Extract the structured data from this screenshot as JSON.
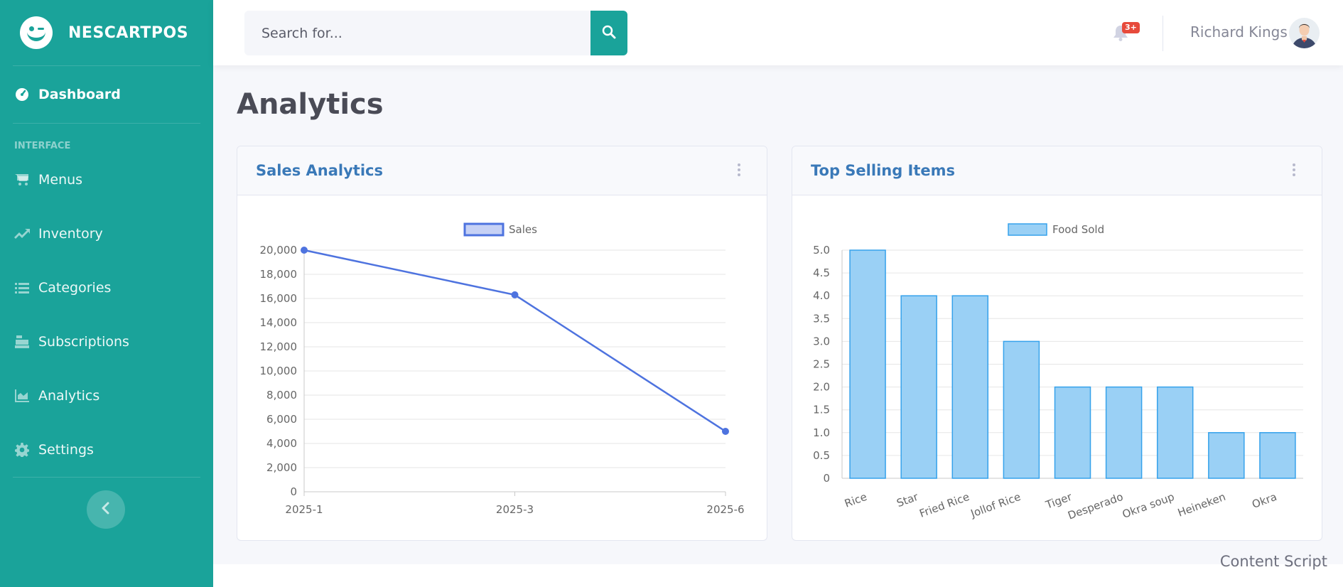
{
  "brand": {
    "name": "NESCARTPOS"
  },
  "sidebar": {
    "active_item": {
      "label": "Dashboard",
      "icon": "gauge-icon"
    },
    "section_heading": "INTERFACE",
    "items": [
      {
        "label": "Menus",
        "icon": "cart-icon"
      },
      {
        "label": "Inventory",
        "icon": "trend-up-icon"
      },
      {
        "label": "Categories",
        "icon": "list-icon"
      },
      {
        "label": "Subscriptions",
        "icon": "cash-register-icon"
      },
      {
        "label": "Analytics",
        "icon": "area-chart-icon"
      },
      {
        "label": "Settings",
        "icon": "gear-icon"
      }
    ],
    "collapse_icon": "chevron-left-icon"
  },
  "topbar": {
    "search_placeholder": "Search for...",
    "alerts_badge": "3+",
    "user_name": "Richard Kings"
  },
  "page": {
    "title": "Analytics"
  },
  "cards": {
    "sales": {
      "title": "Sales Analytics"
    },
    "top_items": {
      "title": "Top Selling Items"
    }
  },
  "footer": {
    "text": "Content Script"
  },
  "colors": {
    "teal": "#1aa39a",
    "line": "#4e73df",
    "bar_fill": "#9ad0f5",
    "bar_border": "#36a2eb",
    "title_blue": "#3a79b8"
  },
  "chart_data": [
    {
      "type": "line",
      "legend": [
        "Sales"
      ],
      "x": [
        "2025-1",
        "2025-3",
        "2025-6"
      ],
      "series": [
        {
          "name": "Sales",
          "values": [
            20000,
            16300,
            5000
          ]
        }
      ],
      "ylim": [
        0,
        20000
      ],
      "yticks": [
        "0",
        "2,000",
        "4,000",
        "6,000",
        "8,000",
        "10,000",
        "12,000",
        "14,000",
        "16,000",
        "18,000",
        "20,000"
      ],
      "grid": true,
      "legend_position": "top"
    },
    {
      "type": "bar",
      "legend": [
        "Food Sold"
      ],
      "categories": [
        "Rice",
        "Star",
        "Fried Rice",
        "Jollof Rice",
        "Tiger",
        "Desperado",
        "Okra soup",
        "Heineken",
        "Okra"
      ],
      "series": [
        {
          "name": "Food Sold",
          "values": [
            5,
            4,
            4,
            3,
            2,
            2,
            2,
            1,
            1
          ]
        }
      ],
      "ylim": [
        0,
        5
      ],
      "yticks": [
        "0",
        "0.5",
        "1.0",
        "1.5",
        "2.0",
        "2.5",
        "3.0",
        "3.5",
        "4.0",
        "4.5",
        "5.0"
      ],
      "grid": true,
      "legend_position": "top"
    }
  ]
}
